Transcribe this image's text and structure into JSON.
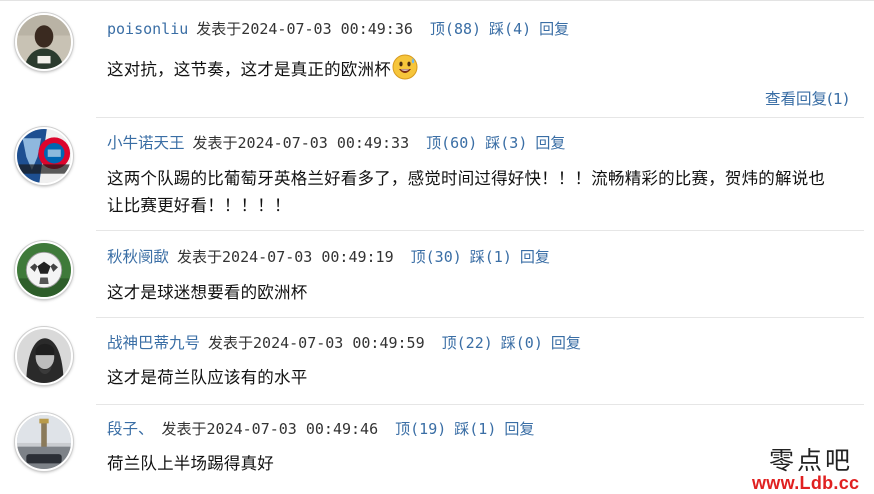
{
  "comments": [
    {
      "username": "poisonliu",
      "posted_label": "发表于",
      "datetime": "2024-07-03 00:49:36",
      "up_label": "顶(88)",
      "down_label": "踩(4)",
      "reply_label": "回复",
      "text": "这对抗，这节奏，这才是真正的欧洲杯",
      "emoji": "grinning-sweat-emoji",
      "view_replies": "查看回复(1)"
    },
    {
      "username": "小牛诺天王",
      "posted_label": "发表于",
      "datetime": "2024-07-03 00:49:33",
      "up_label": "顶(60)",
      "down_label": "踩(3)",
      "reply_label": "回复",
      "text_line1": "这两个队踢的比葡萄牙英格兰好看多了，感觉时间过得好快！！！流畅精彩的比赛，贺炜的解说也",
      "text_line2": "让比赛更好看！！！！！"
    },
    {
      "username": "秋秋阌歃",
      "posted_label": "发表于",
      "datetime": "2024-07-03 00:49:19",
      "up_label": "顶(30)",
      "down_label": "踩(1)",
      "reply_label": "回复",
      "text": "这才是球迷想要看的欧洲杯"
    },
    {
      "username": "战神巴蒂九号",
      "posted_label": "发表于",
      "datetime": "2024-07-03 00:49:59",
      "up_label": "顶(22)",
      "down_label": "踩(0)",
      "reply_label": "回复",
      "text": "这才是荷兰队应该有的水平"
    },
    {
      "username": "段子、",
      "posted_label": "发表于",
      "datetime": "2024-07-03 00:49:46",
      "up_label": "顶(19)",
      "down_label": "踩(1)",
      "reply_label": "回复",
      "text": "荷兰队上半场踢得真好"
    }
  ],
  "watermark": {
    "site_name": "零点吧",
    "url": "www.Ldb.cc"
  },
  "colors": {
    "link": "#3a6ea5",
    "text": "#111111",
    "divider": "#e6e6e6",
    "watermark_url": "#e02020"
  }
}
